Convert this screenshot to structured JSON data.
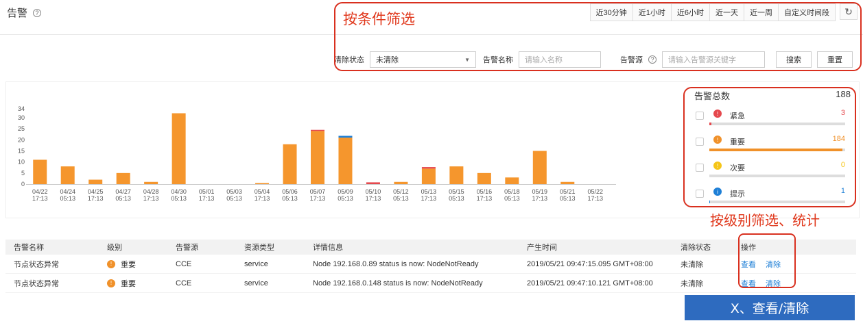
{
  "header": {
    "title": "告警",
    "help_glyph": "?"
  },
  "time_tabs": [
    "近30分钟",
    "近1小时",
    "近6小时",
    "近一天",
    "近一周",
    "自定义时间段"
  ],
  "refresh_glyph": "↻",
  "filters": {
    "clear_status_label": "清除状态",
    "clear_status_value": "未清除",
    "alarm_name_label": "告警名称",
    "alarm_name_placeholder": "请输入名称",
    "alarm_source_label": "告警源",
    "alarm_source_placeholder": "请输入告警源关键字",
    "search_label": "搜索",
    "reset_label": "重置"
  },
  "annotations": {
    "filter": "按条件筛选",
    "level": "按级别筛选、统计",
    "banner": "X、查看/清除"
  },
  "summary": {
    "title": "告警总数",
    "total": "188",
    "levels": [
      {
        "name": "紧急",
        "count": "3",
        "color": "#e5484d",
        "glyph": "!",
        "fraction": 0.016
      },
      {
        "name": "重要",
        "count": "184",
        "color": "#f0912a",
        "glyph": "!",
        "fraction": 0.979
      },
      {
        "name": "次要",
        "count": "0",
        "color": "#f5c518",
        "glyph": "!",
        "fraction": 0
      },
      {
        "name": "提示",
        "count": "1",
        "color": "#1e7fd6",
        "glyph": "i",
        "fraction": 0.005
      }
    ]
  },
  "colors": {
    "bar_main": "#f5962d",
    "bar_critical": "#e5484d",
    "bar_hint": "#1e7fd6"
  },
  "chart_data": {
    "type": "bar",
    "y_ticks": [
      0,
      5,
      10,
      15,
      20,
      25,
      30,
      34
    ],
    "ylim": [
      0,
      34
    ],
    "categories": [
      {
        "date": "04/22",
        "time": "17:13"
      },
      {
        "date": "04/24",
        "time": "05:13"
      },
      {
        "date": "04/25",
        "time": "17:13"
      },
      {
        "date": "04/27",
        "time": "05:13"
      },
      {
        "date": "04/28",
        "time": "17:13"
      },
      {
        "date": "04/30",
        "time": "05:13"
      },
      {
        "date": "05/01",
        "time": "17:13"
      },
      {
        "date": "05/03",
        "time": "05:13"
      },
      {
        "date": "05/04",
        "time": "17:13"
      },
      {
        "date": "05/06",
        "time": "05:13"
      },
      {
        "date": "05/07",
        "time": "17:13"
      },
      {
        "date": "05/09",
        "time": "05:13"
      },
      {
        "date": "05/10",
        "time": "17:13"
      },
      {
        "date": "05/12",
        "time": "05:13"
      },
      {
        "date": "05/13",
        "time": "17:13"
      },
      {
        "date": "05/15",
        "time": "05:13"
      },
      {
        "date": "05/16",
        "time": "17:13"
      },
      {
        "date": "05/18",
        "time": "05:13"
      },
      {
        "date": "05/19",
        "time": "17:13"
      },
      {
        "date": "05/21",
        "time": "05:13"
      },
      {
        "date": "05/22",
        "time": "17:13"
      }
    ],
    "series": [
      {
        "key": "important",
        "values": [
          11,
          8,
          2,
          5,
          1,
          32,
          0,
          0,
          0.5,
          18,
          24,
          21,
          0,
          1,
          7,
          8,
          5,
          3,
          15,
          1,
          0
        ]
      },
      {
        "key": "critical",
        "values": [
          0,
          0,
          0,
          0,
          0,
          0,
          0,
          0,
          0,
          0,
          0.5,
          0,
          0.8,
          0,
          0.7,
          0,
          0,
          0,
          0,
          0,
          0
        ]
      },
      {
        "key": "hint",
        "values": [
          0,
          0,
          0,
          0,
          0,
          0,
          0,
          0,
          0,
          0,
          0,
          0.8,
          0,
          0,
          0,
          0,
          0,
          0,
          0,
          0,
          0
        ]
      }
    ]
  },
  "table": {
    "headers": [
      "告警名称",
      "级别",
      "告警源",
      "资源类型",
      "详情信息",
      "产生时间",
      "清除状态",
      "操作"
    ],
    "rows": [
      {
        "name": "节点状态异常",
        "level": "重要",
        "source": "CCE",
        "resource": "service",
        "detail": "Node 192.168.0.89 status is now: NodeNotReady",
        "time": "2019/05/21 09:47:15.095 GMT+08:00",
        "status": "未清除",
        "view": "查看",
        "clear": "清除"
      },
      {
        "name": "节点状态异常",
        "level": "重要",
        "source": "CCE",
        "resource": "service",
        "detail": "Node 192.168.0.148 status is now: NodeNotReady",
        "time": "2019/05/21 09:47:10.121 GMT+08:00",
        "status": "未清除",
        "view": "查看",
        "clear": "清除"
      }
    ]
  }
}
